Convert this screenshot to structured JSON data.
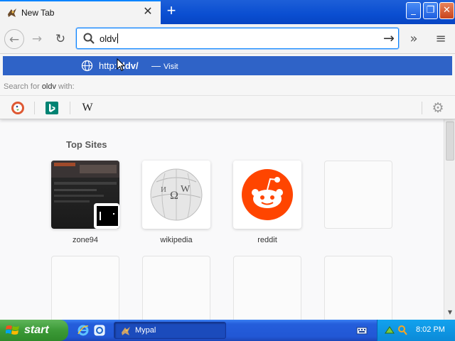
{
  "window": {
    "tab_title": "New Tab",
    "tab_close_glyph": "✕",
    "new_tab_glyph": "+",
    "controls": {
      "minimize": "_",
      "maximize": "❐",
      "close": "✕"
    }
  },
  "navbar": {
    "back_glyph": "←",
    "forward_glyph": "→",
    "reload_glyph": "↻",
    "url_value": "oldv",
    "go_glyph": "→",
    "overflow_glyph": "»",
    "menu_glyph": "≡"
  },
  "dropdown": {
    "suggestion": {
      "url_prefix": "http:",
      "url_bold": "oldv/",
      "separator": "—",
      "action": "Visit"
    },
    "search_with": {
      "prefix": "Search for ",
      "query": "oldv",
      "suffix": " with:"
    },
    "engines": [
      {
        "name": "DuckDuckGo",
        "icon": "duckduckgo-icon"
      },
      {
        "name": "Bing",
        "icon": "bing-icon"
      },
      {
        "name": "Wikipedia",
        "icon": "wikipedia-icon",
        "glyph": "W"
      }
    ],
    "settings_glyph": "⚙"
  },
  "content": {
    "top_sites_title": "Top Sites",
    "sites": [
      {
        "label": "zone94",
        "kind": "screenshot"
      },
      {
        "label": "wikipedia",
        "kind": "icon",
        "icon": "wikipedia-globe-icon"
      },
      {
        "label": "reddit",
        "kind": "icon",
        "icon": "reddit-icon"
      },
      {
        "label": "",
        "kind": "empty"
      },
      {
        "label": "",
        "kind": "empty"
      },
      {
        "label": "",
        "kind": "empty"
      },
      {
        "label": "",
        "kind": "empty"
      },
      {
        "label": "",
        "kind": "empty"
      }
    ]
  },
  "taskbar": {
    "start_label": "start",
    "task_label": "Mypal",
    "clock": "8:02 PM"
  },
  "colors": {
    "accent": "#0a84ff",
    "suggestion_bg": "#2f63c7",
    "reddit": "#ff4500",
    "taskbar": "#245edb",
    "start": "#3c9a37"
  }
}
